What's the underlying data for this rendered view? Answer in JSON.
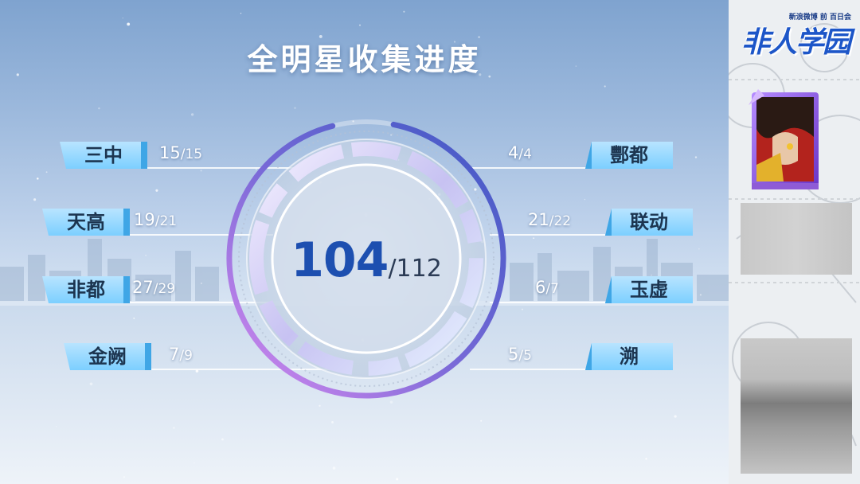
{
  "title": "全明星收集进度",
  "total": {
    "collected": "104",
    "max": "/112",
    "fraction": 0.9286
  },
  "left_groups": [
    {
      "name": "三中",
      "collected": "15",
      "total": "/15"
    },
    {
      "name": "天高",
      "collected": "19",
      "total": "/21"
    },
    {
      "name": "非都",
      "collected": "27",
      "total": "/29"
    },
    {
      "name": "金阙",
      "collected": "7",
      "total": "/9"
    }
  ],
  "right_groups": [
    {
      "name": "酆都",
      "collected": "4",
      "total": "/4"
    },
    {
      "name": "联动",
      "collected": "21",
      "total": "/22"
    },
    {
      "name": "玉虚",
      "collected": "6",
      "total": "/7"
    },
    {
      "name": "溯",
      "collected": "5",
      "total": "/5"
    }
  ],
  "sidebar": {
    "logo_sub": "新浪微博 前 百日会",
    "logo_main": "非人学园"
  },
  "colors": {
    "accent": "#1d4fb0",
    "tag": "#7ccfff",
    "ring": "#5a55c9"
  }
}
